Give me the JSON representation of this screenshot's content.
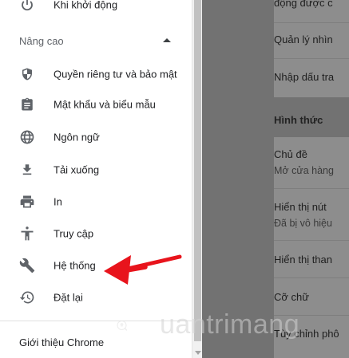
{
  "drawer": {
    "top_item_label": "Khi khởi động",
    "advanced_section": "Nâng cao",
    "items": [
      {
        "label": "Quyền riêng tư và bảo mật",
        "icon": "shield-icon"
      },
      {
        "label": "Mật khẩu và biểu mẫu",
        "icon": "clipboard-icon"
      },
      {
        "label": "Ngôn ngữ",
        "icon": "globe-icon"
      },
      {
        "label": "Tải xuống",
        "icon": "download-icon"
      },
      {
        "label": "In",
        "icon": "printer-icon"
      },
      {
        "label": "Truy cập",
        "icon": "accessibility-icon"
      },
      {
        "label": "Hệ thống",
        "icon": "wrench-icon"
      },
      {
        "label": "Đặt lại",
        "icon": "restore-icon"
      }
    ],
    "about_label": "Giới thiệu Chrome"
  },
  "content": {
    "rows_top": [
      "động được c",
      "Quản lý nhìn",
      "Nhập dấu tra"
    ],
    "section_title": "Hình thức",
    "appearance_rows": [
      {
        "title": "Chủ đề",
        "sub": "Mở cửa hàng"
      },
      {
        "title": "Hiển thị nút",
        "sub": "Đã bị vô hiệu"
      },
      {
        "title": "Hiển thị than",
        "sub": ""
      },
      {
        "title": "Cỡ chữ",
        "sub": ""
      },
      {
        "title": "Tùy chỉnh phô",
        "sub": ""
      }
    ]
  },
  "watermark": {
    "text": "uantrimang"
  },
  "colors": {
    "annotation_arrow": "#e8141c",
    "overlay": "#727272",
    "drawer_bg": "#ffffff"
  }
}
